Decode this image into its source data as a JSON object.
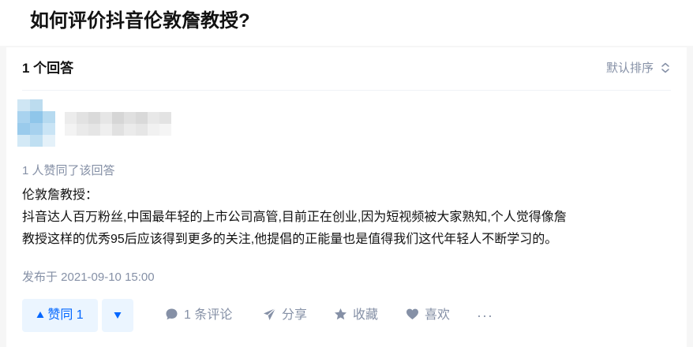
{
  "question": {
    "title": "如何评价抖音伦敦詹教授?"
  },
  "answers_header": {
    "count_label": "1 个回答",
    "sort_label": "默认排序"
  },
  "answer": {
    "voters_text": "1 人赞同了该回答",
    "content_lines": [
      "伦敦詹教授：",
      "抖音达人百万粉丝,中国最年轻的上市公司高管,目前正在创业,因为短视频被大家熟知,个人觉得像詹",
      "教授这样的优秀95后应该得到更多的关注,他提倡的正能量也是值得我们这代年轻人不断学习的。"
    ],
    "published": "发布于 2021-09-10 15:00",
    "vote_up_label": "赞同 1",
    "actions": {
      "comment": "1 条评论",
      "share": "分享",
      "favorite": "收藏",
      "like": "喜欢",
      "more": "···"
    }
  },
  "colors": {
    "accent": "#0066ff",
    "accent_bg": "#ebf5ff",
    "muted": "#8590a6"
  },
  "icons": [
    "chevron-up-down-icon",
    "triangle-up-icon",
    "triangle-down-icon",
    "comment-bubble-icon",
    "paper-plane-icon",
    "star-icon",
    "heart-icon",
    "ellipsis-icon"
  ]
}
